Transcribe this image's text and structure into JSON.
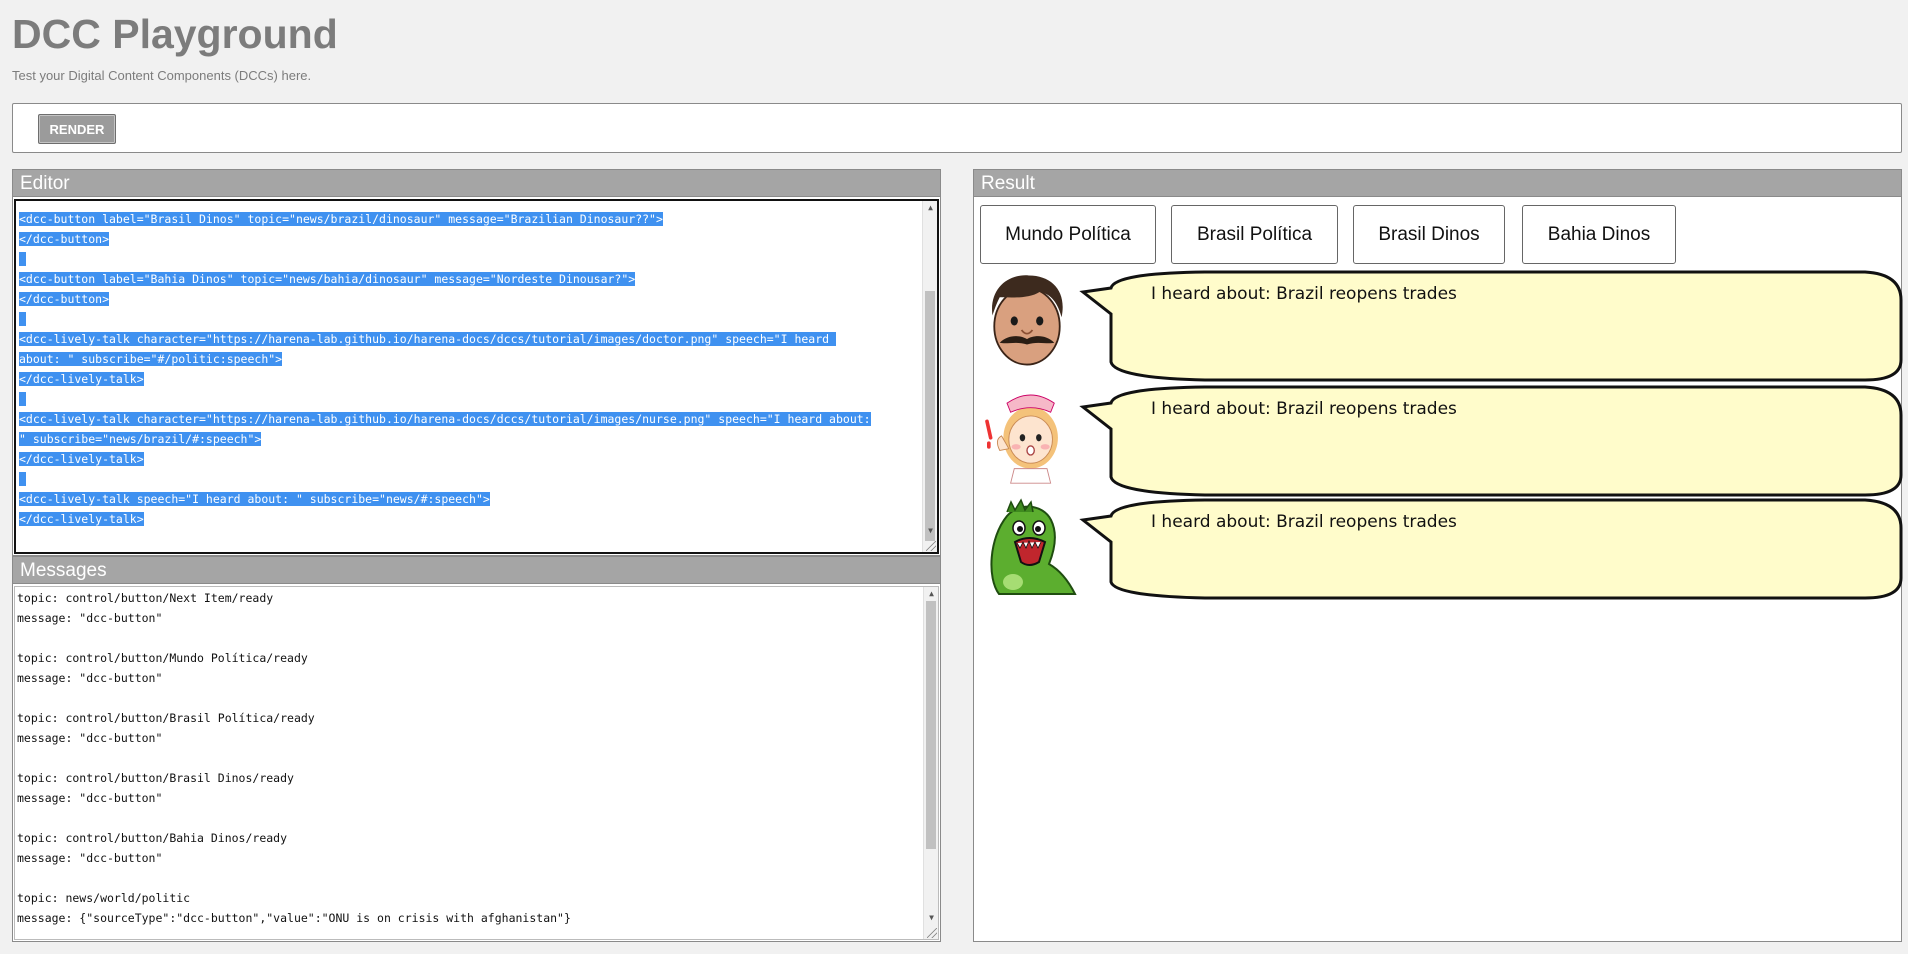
{
  "app": {
    "title": "DCC Playground",
    "subtitle": "Test your Digital Content Components (DCCs) here."
  },
  "toolbar": {
    "render_label": "RENDER"
  },
  "editor": {
    "title": "Editor",
    "lines": [
      "<dcc-button label=\"Brasil Dinos\" topic=\"news/brazil/dinosaur\" message=\"Brazilian Dinosaur??\">",
      "</dcc-button>",
      "",
      "<dcc-button label=\"Bahia Dinos\" topic=\"news/bahia/dinosaur\" message=\"Nordeste Dinousar?\">",
      "</dcc-button>",
      "",
      "<dcc-lively-talk character=\"https://harena-lab.github.io/harena-docs/dccs/tutorial/images/doctor.png\" speech=\"I heard ",
      "about: \" subscribe=\"#/politic:speech\">",
      "</dcc-lively-talk>",
      "",
      "<dcc-lively-talk character=\"https://harena-lab.github.io/harena-docs/dccs/tutorial/images/nurse.png\" speech=\"I heard about:",
      "\" subscribe=\"news/brazil/#:speech\">",
      "</dcc-lively-talk>",
      "",
      "<dcc-lively-talk speech=\"I heard about: \" subscribe=\"news/#:speech\">",
      "</dcc-lively-talk>"
    ]
  },
  "messages": {
    "title": "Messages",
    "lines": [
      "topic: control/button/Next Item/ready",
      "message: \"dcc-button\"",
      "",
      "topic: control/button/Mundo Política/ready",
      "message: \"dcc-button\"",
      "",
      "topic: control/button/Brasil Política/ready",
      "message: \"dcc-button\"",
      "",
      "topic: control/button/Brasil Dinos/ready",
      "message: \"dcc-button\"",
      "",
      "topic: control/button/Bahia Dinos/ready",
      "message: \"dcc-button\"",
      "",
      "topic: news/world/politic",
      "message: {\"sourceType\":\"dcc-button\",\"value\":\"ONU is on crisis with afghanistan\"}"
    ]
  },
  "result": {
    "title": "Result",
    "buttons": [
      "Mundo Política",
      "Brasil Política",
      "Brasil Dinos",
      "Bahia Dinos"
    ],
    "talks": [
      {
        "character": "doctor",
        "speech": "I heard about: Brazil reopens trades"
      },
      {
        "character": "nurse",
        "speech": "I heard about: Brazil reopens trades"
      },
      {
        "character": "dinosaur",
        "speech": "I heard about: Brazil reopens trades"
      }
    ]
  },
  "colors": {
    "selection": "#3f91f0",
    "panel_header": "#a5a5a5",
    "bubble_fill": "#fffccb",
    "title_text": "#7c7c7c"
  }
}
